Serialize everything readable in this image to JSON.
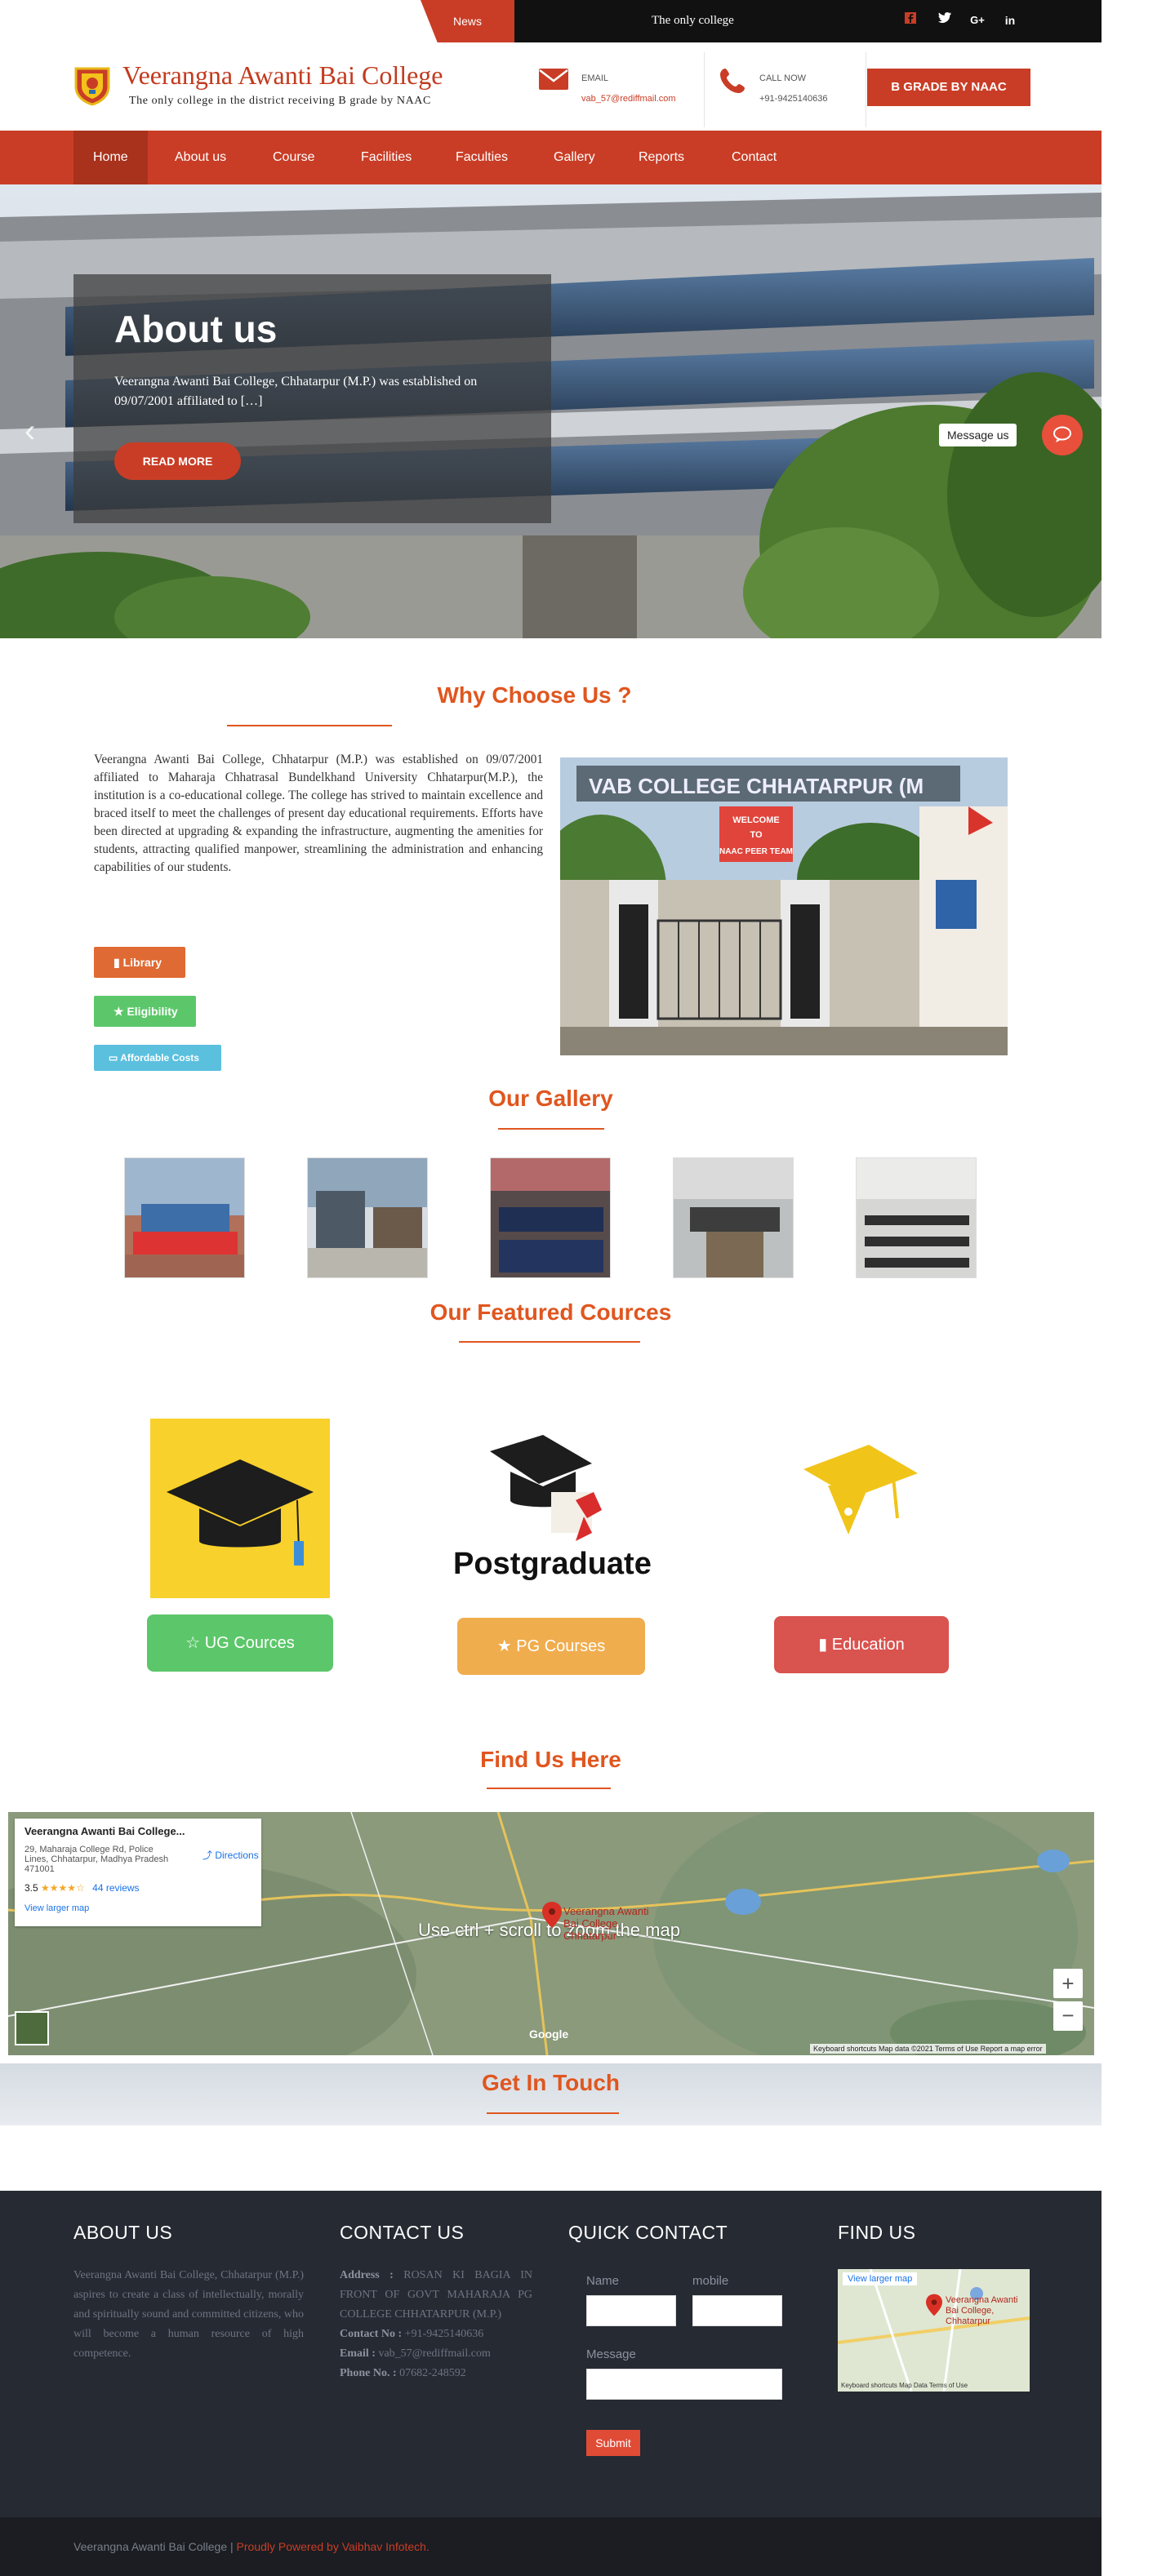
{
  "topbar": {
    "news_label": "News",
    "ticker": "The only college",
    "social_icons": [
      "facebook-icon",
      "twitter-icon",
      "google-plus-icon",
      "linkedin-icon"
    ]
  },
  "header": {
    "title": "Veerangna Awanti Bai College",
    "subtitle": "The only college in the district receiving B grade by NAAC",
    "email_label": "EMAIL",
    "email_value": "vab_57@rediffmail.com",
    "call_label": "CALL NOW",
    "call_value": "+91-9425140636",
    "grade_button": "B GRADE BY NAAC"
  },
  "nav": {
    "items": [
      "Home",
      "About us",
      "Course",
      "Facilities",
      "Faculties",
      "Gallery",
      "Reports",
      "Contact"
    ],
    "active": "Home"
  },
  "hero": {
    "title": "About us",
    "text": "Veerangna Awanti Bai College, Chhatarpur (M.P.) was established on 09/07/2001 affiliated to […]",
    "button": "READ MORE",
    "message_label": "Message us"
  },
  "why": {
    "title": "Why Choose Us ?",
    "text": "Veerangna Awanti Bai College, Chhatarpur (M.P.) was established on 09/07/2001 affiliated to Maharaja Chhatrasal Bundelkhand University Chhatarpur(M.P.), the institution is a co-educational college. The college has strived to maintain excellence and braced itself to meet the challenges of present day educational requirements. Efforts have been directed at upgrading & expanding the infrastructure, augmenting the amenities for students, attracting qualified manpower, streamlining the administration and enhancing capabilities of our students.",
    "pills": [
      "Library",
      "Eligibility",
      "Affordable Costs"
    ],
    "photo_sign": "VAB COLLEGE CHHATARPUR (M",
    "photo_banner": [
      "WELCOME",
      "TO",
      "NAAC PEER TEAM"
    ]
  },
  "gallery": {
    "title": "Our Gallery"
  },
  "courses": {
    "title": "Our Featured Cources",
    "pg_image_text": "Postgraduate",
    "items": [
      "UG Cources",
      "PG Courses",
      "Education"
    ],
    "colors": [
      "#5cc76a",
      "#f0ad4e",
      "#d9534f"
    ]
  },
  "map": {
    "title": "Find Us Here",
    "place_name": "Veerangna Awanti Bai College...",
    "address": "29, Maharaja College Rd, Police Lines, Chhatarpur, Madhya Pradesh 471001",
    "rating": "3.5",
    "stars": "★★★★☆",
    "reviews": "44 reviews",
    "directions": "Directions",
    "view_larger": "View larger map",
    "zoom_hint": "Use ctrl + scroll to zoom the map",
    "pin_label": "Veerangna Awanti Bai College, Chhatarpur",
    "attribution": "Keyboard shortcuts   Map data ©2021   Terms of Use   Report a map error",
    "google": "Google"
  },
  "touch": {
    "title": "Get In Touch"
  },
  "footer": {
    "about_title": "ABOUT US",
    "about_text": "Veerangna Awanti Bai College, Chhatarpur (M.P.) aspires to create a class of intellectually, morally and spiritually sound and committed citizens, who will become a human resource of high competence.",
    "contact_title": "CONTACT US",
    "address_label": "Address :",
    "address": "ROSAN KI BAGIA IN FRONT OF GOVT MAHARAJA PG COLLEGE CHHATARPUR (M.P.)",
    "contact_no_label": "Contact No :",
    "contact_no": "+91-9425140636",
    "email_label": "Email :",
    "email": "vab_57@rediffmail.com",
    "phone_label": "Phone No. :",
    "phone": "07682-248592",
    "quick_title": "QUICK CONTACT",
    "name_label": "Name",
    "mobile_label": "mobile",
    "message_label": "Message",
    "submit": "Submit",
    "find_title": "FIND US",
    "mini_map_link": "View larger map",
    "mini_map_pin": "Veerangna Awanti Bai College, Chhatarpur",
    "mini_map_attr": "Keyboard shortcuts   Map Data   Terms of Use"
  },
  "copyright": {
    "text": "Veerangna Awanti Bai College | ",
    "link": "Proudly Powered by Vaibhav Infotech."
  }
}
